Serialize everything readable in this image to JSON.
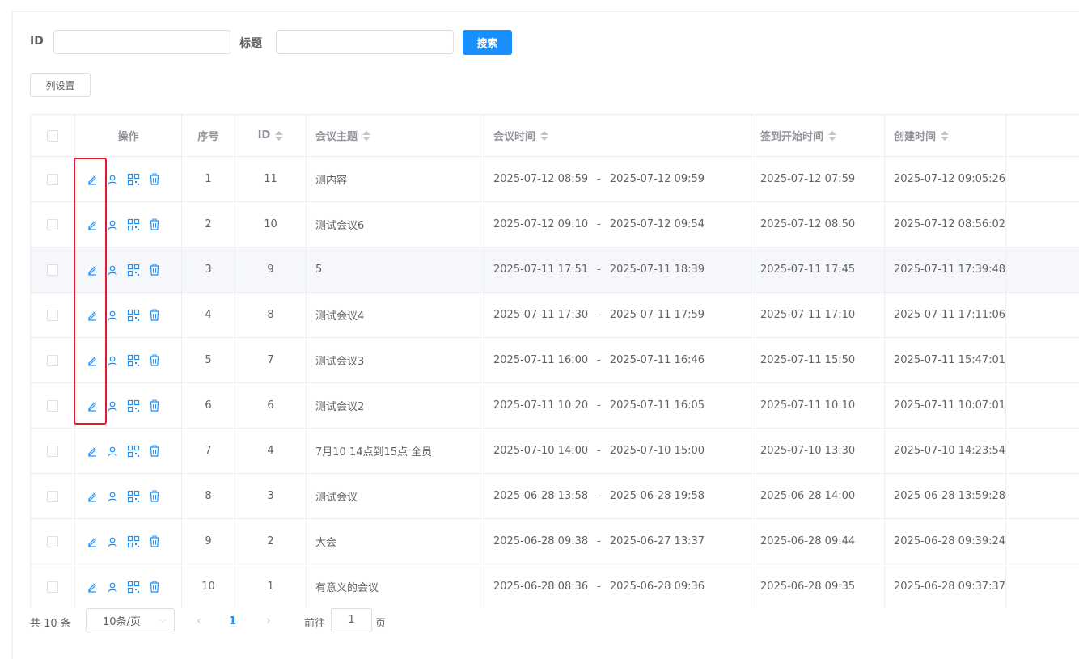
{
  "search": {
    "id_label": "ID",
    "id_value": "",
    "title_label": "标题",
    "title_value": "",
    "search_button": "搜索"
  },
  "toolbar": {
    "column_settings": "列设置"
  },
  "table": {
    "headers": {
      "ops": "操作",
      "seq": "序号",
      "id": "ID",
      "topic": "会议主题",
      "time": "会议时间",
      "checkin": "签到开始时间",
      "created": "创建时间"
    },
    "rows": [
      {
        "seq": "1",
        "id": "11",
        "topic": "测内容",
        "start": "2025-07-12 08:59",
        "sep": "-",
        "end": "2025-07-12 09:59",
        "checkin": "2025-07-12 07:59",
        "created": "2025-07-12 09:05:26"
      },
      {
        "seq": "2",
        "id": "10",
        "topic": "测试会议6",
        "start": "2025-07-12 09:10",
        "sep": "-",
        "end": "2025-07-12 09:54",
        "checkin": "2025-07-12 08:50",
        "created": "2025-07-12 08:56:02"
      },
      {
        "seq": "3",
        "id": "9",
        "topic": "5",
        "start": "2025-07-11 17:51",
        "sep": "-",
        "end": "2025-07-11 18:39",
        "checkin": "2025-07-11 17:45",
        "created": "2025-07-11 17:39:48"
      },
      {
        "seq": "4",
        "id": "8",
        "topic": "测试会议4",
        "start": "2025-07-11 17:30",
        "sep": "-",
        "end": "2025-07-11 17:59",
        "checkin": "2025-07-11 17:10",
        "created": "2025-07-11 17:11:06"
      },
      {
        "seq": "5",
        "id": "7",
        "topic": "测试会议3",
        "start": "2025-07-11 16:00",
        "sep": "-",
        "end": "2025-07-11 16:46",
        "checkin": "2025-07-11 15:50",
        "created": "2025-07-11 15:47:01"
      },
      {
        "seq": "6",
        "id": "6",
        "topic": "测试会议2",
        "start": "2025-07-11 10:20",
        "sep": "-",
        "end": "2025-07-11 16:05",
        "checkin": "2025-07-11 10:10",
        "created": "2025-07-11 10:07:01"
      },
      {
        "seq": "7",
        "id": "4",
        "topic": "7月10 14点到15点 全员",
        "start": "2025-07-10 14:00",
        "sep": "-",
        "end": "2025-07-10 15:00",
        "checkin": "2025-07-10 13:30",
        "created": "2025-07-10 14:23:54"
      },
      {
        "seq": "8",
        "id": "3",
        "topic": "测试会议",
        "start": "2025-06-28 13:58",
        "sep": "-",
        "end": "2025-06-28 19:58",
        "checkin": "2025-06-28 14:00",
        "created": "2025-06-28 13:59:28"
      },
      {
        "seq": "9",
        "id": "2",
        "topic": "大会",
        "start": "2025-06-28 09:38",
        "sep": "-",
        "end": "2025-06-27 13:37",
        "checkin": "2025-06-28 09:44",
        "created": "2025-06-28 09:39:24"
      },
      {
        "seq": "10",
        "id": "1",
        "topic": "有意义的会议",
        "start": "2025-06-28 08:36",
        "sep": "-",
        "end": "2025-06-28 09:36",
        "checkin": "2025-06-28 09:35",
        "created": "2025-06-28 09:37:37"
      }
    ]
  },
  "pagination": {
    "total": "共 10 条",
    "page_size": "10条/页",
    "current_page": "1",
    "goto_label": "前往",
    "goto_value": "1",
    "page_suffix": "页"
  },
  "colors": {
    "primary": "#1890ff",
    "highlight_box": "#e8182a",
    "hover_row": "#f5f7fa"
  },
  "icons": [
    "edit-icon",
    "user-icon",
    "qrcode-icon",
    "delete-icon"
  ]
}
